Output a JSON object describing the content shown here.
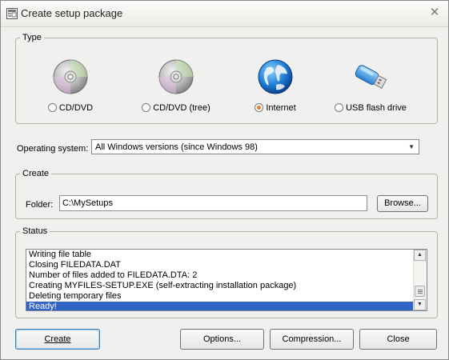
{
  "window": {
    "title": "Create setup package",
    "close_glyph": "✕"
  },
  "type_group": {
    "legend": "Type",
    "options": [
      {
        "label": "CD/DVD",
        "icon": "cd-icon",
        "checked": false
      },
      {
        "label": "CD/DVD (tree)",
        "icon": "cd-icon",
        "checked": false
      },
      {
        "label": "Internet",
        "icon": "globe-icon",
        "checked": true
      },
      {
        "label": "USB flash drive",
        "icon": "usb-drive-icon",
        "checked": false
      }
    ]
  },
  "os": {
    "label": "Operating system:",
    "value": "All Windows versions (since Windows 98)"
  },
  "create_group": {
    "legend": "Create",
    "folder_label": "Folder:",
    "folder_value": "C:\\MySetups",
    "browse_label": "Browse..."
  },
  "status_group": {
    "legend": "Status",
    "lines": [
      "Writing file table",
      "Closing FILEDATA.DAT",
      "Number of files added to FILEDATA.DTA: 2",
      "Creating MYFILES-SETUP.EXE (self-extracting installation package)",
      "Deleting temporary files",
      "Ready!"
    ],
    "selected_index": 5
  },
  "buttons": {
    "create": "Create",
    "options": "Options...",
    "compression": "Compression...",
    "close": "Close"
  },
  "colors": {
    "selection": "#3165c5",
    "radio_dot": "#e87c24"
  }
}
